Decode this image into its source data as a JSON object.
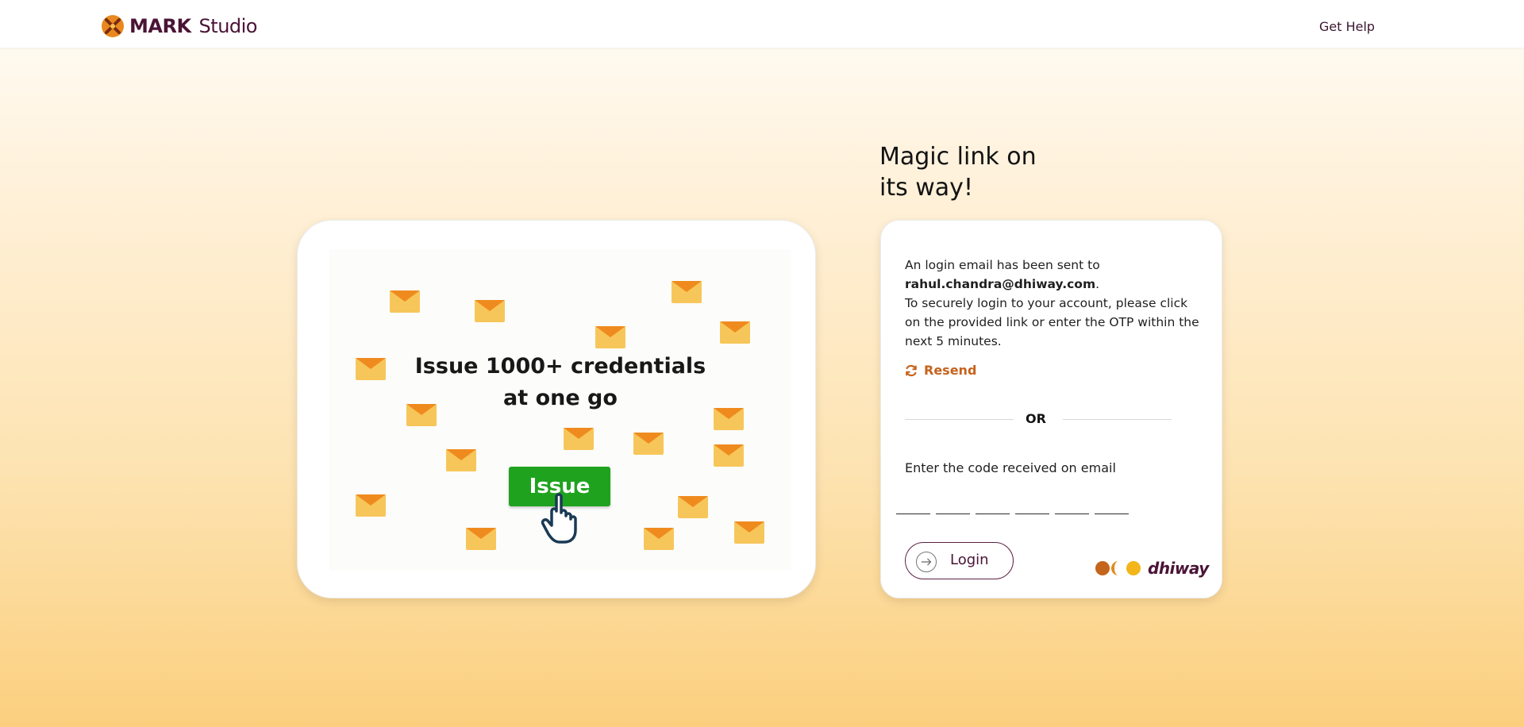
{
  "header": {
    "brand_bold": "MARK",
    "brand_light": "Studio",
    "help_label": "Get Help"
  },
  "promo": {
    "heading_line1": "Issue 1000+ credentials",
    "heading_line2": "at one go",
    "issue_label": "Issue"
  },
  "login": {
    "title_line1": "Magic link on",
    "title_line2": "its way!",
    "message_prefix": "An login email has been sent to",
    "email": "rahul.chandra@dhiway.com",
    "message_suffix": ".",
    "message_body": "To securely login to your account, please click on the provided link or enter the OTP within the next 5 minutes.",
    "resend_label": "Resend",
    "or_label": "OR",
    "code_label": "Enter the code received on email",
    "otp_values": [
      "",
      "",
      "",
      "",
      "",
      ""
    ],
    "login_label": "Login",
    "partner_logo_text": "dhiway"
  },
  "colors": {
    "accent": "#c6621c",
    "brand": "#4a1436",
    "issue_green": "#1fa31f"
  }
}
